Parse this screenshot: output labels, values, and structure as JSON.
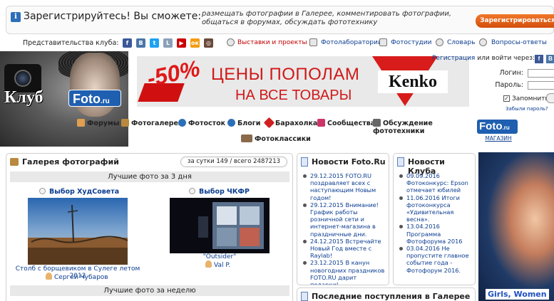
{
  "registration": {
    "title": "Зарегистрируйтесь! Вы сможете:",
    "description": "размещать фотографии в Галерее, комментировать фотографии, общаться в форумах, обсуждать фототехнику",
    "button": "Зарегистрироваться"
  },
  "representations": {
    "label": "Представительства клуба:",
    "social_icons": [
      "facebook-icon",
      "vk-icon",
      "twitter-icon",
      "livejournal-icon",
      "youtube-icon",
      "odnoklassniki-icon",
      "instagram-icon"
    ],
    "links": [
      "Выставки и проекты",
      "Фотолаборатории",
      "Фотостудии",
      "Словарь",
      "Вопросы-ответы"
    ]
  },
  "logo": {
    "text": "Клуб",
    "foto": "Foto",
    "suffix": ".ru"
  },
  "banner": {
    "discount": "-50%",
    "line1": "ЦЕНЫ ПОПОЛАМ",
    "line2": "НА ВСЕ ТОВАРЫ",
    "brand": "Kenko"
  },
  "login": {
    "register_link": "Регистрация",
    "or_login_via": "или войти через:",
    "login_label": "Логин:",
    "password_label": "Пароль:",
    "remember_label": "Запомнить",
    "forgot_link": "Забыли пароль?"
  },
  "nav": {
    "items": [
      "Форумы",
      "Фотогалерея",
      "Фотосток",
      "Блоги",
      "Барахолка",
      "Сообщества",
      "Обсуждение фототехники",
      "Фотоклассики"
    ],
    "shop": {
      "logo": "Foto",
      "suffix": ".ru",
      "label": "МАГАЗИН"
    }
  },
  "gallery": {
    "title": "Галерея фотографий",
    "counter": "за сутки 149 / всего 2487213",
    "best_3days": "Лучшие фото за 3 дня",
    "best_week": "Лучшие фото за неделю",
    "photos": [
      {
        "choice": "Выбор ХудСовета",
        "caption": "Столб с борщевиком в Сулеге летом 2012",
        "author": "Сергей Чубаров"
      },
      {
        "choice": "Выбор ЧКФР",
        "caption": "\"Outsider\"",
        "author": "Val P."
      }
    ]
  },
  "news_foto": {
    "title": "Новости Foto.Ru",
    "items": [
      "29.12.2015 FOTO.RU поздравляет всех с наступающим Новым годом!",
      "29.12.2015 Внимание! График работы розничной сети и интернет-магазина в праздничные дни.",
      "24.12.2015 Встречайте Новый Год вместе с Raylab!",
      "23.12.2015 В канун новогодних праздников FOTO.RU дарит подарки!"
    ]
  },
  "news_club": {
    "title": "Новости Клуба",
    "items": [
      "09.09.2016 Фотоконкурс: Epson отмечает юбилей",
      "11.06.2016 Итоги фотоконкурса «Удивительная весна».",
      "13.04.2016 Программа Фотофорума 2016",
      "03.04.2016 Не пропустите главное событие года - Фотофорум 2016."
    ]
  },
  "latest": {
    "title": "Последние поступления в Галерее"
  },
  "ad": {
    "text": "Girls, Women"
  }
}
